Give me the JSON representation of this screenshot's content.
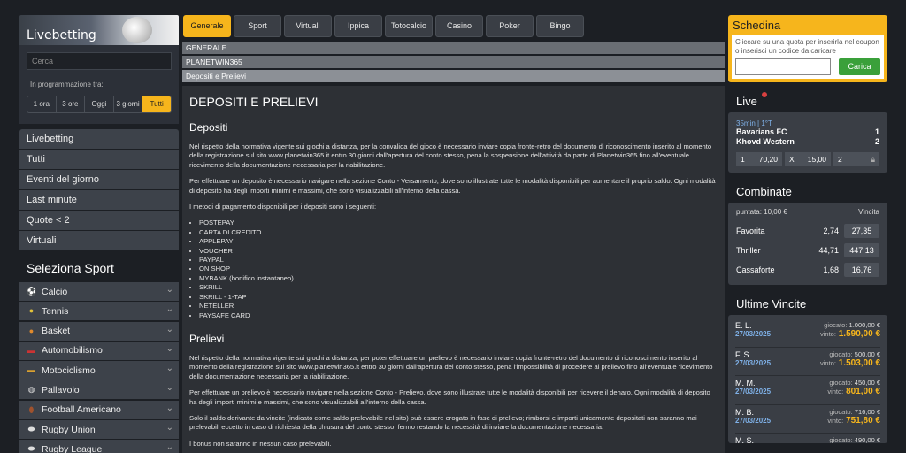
{
  "left": {
    "banner_title": "Livebetting",
    "search_placeholder": "Cerca",
    "prog_label": "In programmazione tra:",
    "time_filters": [
      "1 ora",
      "3 ore",
      "Oggi",
      "3 giorni",
      "Tutti"
    ],
    "time_selected": "Tutti",
    "menu": [
      "Livebetting",
      "Tutti",
      "Eventi del giorno",
      "Last minute",
      "Quote < 2",
      "Virtuali"
    ],
    "sport_title": "Seleziona Sport",
    "sports": [
      "Calcio",
      "Tennis",
      "Basket",
      "Automobilismo",
      "Motociclismo",
      "Pallavolo",
      "Football Americano",
      "Rugby Union",
      "Rugby League"
    ]
  },
  "tabs": [
    "Generale",
    "Sport",
    "Virtuali",
    "Ippica",
    "Totocalcio",
    "Casino",
    "Poker",
    "Bingo"
  ],
  "active_tab": "Generale",
  "breadcrumbs": [
    "GENERALE",
    "PLANETWIN365",
    "Depositi e Prelievi"
  ],
  "content": {
    "title": "DEPOSITI E PRELIEVI",
    "h_depositi": "Depositi",
    "p1": "Nel rispetto della normativa vigente sui giochi a distanza, per la convalida del gioco è necessario inviare copia fronte-retro del documento di riconoscimento inserito al momento della registrazione sul sito www.planetwin365.it entro 30 giorni dall'apertura del conto stesso, pena la sospensione dell'attività da parte di Planetwin365 fino all'eventuale ricevimento della documentazione necessaria per la riabilitazione.",
    "p2": "Per effettuare un deposito è necessario navigare nella sezione Conto - Versamento, dove sono illustrate tutte le modalità disponibili per aumentare il proprio saldo. Ogni modalità di deposito ha degli importi minimi e massimi, che sono visualizzabili all'interno della cassa.",
    "p3": "I metodi di pagamento disponibili per i depositi sono i seguenti:",
    "methods": [
      "POSTEPAY",
      "CARTA DI CREDITO",
      "APPLEPAY",
      "VOUCHER",
      "PAYPAL",
      "ON SHOP",
      "MYBANK (bonifico instantaneo)",
      "SKRILL",
      "SKRILL - 1-TAP",
      "NETELLER",
      "PAYSAFE CARD"
    ],
    "h_prelievi": "Prelievi",
    "p4": "Nel rispetto della normativa vigente sui giochi a distanza, per poter effettuare un prelievo è necessario inviare copia fronte-retro del documento di riconoscimento inserito al momento della registrazione sul sito www.planetwin365.it entro 30 giorni dall'apertura del conto stesso, pena l'impossibilità di procedere al prelievo fino all'eventuale ricevimento della documentazione necessaria per la riabilitazione.",
    "p5": "Per effettuare un prelievo è necessario navigare nella sezione Conto - Prelievo, dove sono illustrate tutte le modalità disponibili per ricevere il denaro. Ogni modalità di deposito ha degli importi minimi e massimi, che sono visualizzabili all'interno della cassa.",
    "p6": "Solo il saldo derivante da vincite (indicato come saldo prelevabile nel sito) può essere erogato in fase di prelievo; rimborsi e importi unicamente depositati non saranno mai prelevabili eccetto in caso di richiesta della chiusura del conto stesso, fermo restando la necessità di inviare la documentazione necessaria.",
    "p7": "I bonus non saranno in nessun caso prelevabili."
  },
  "schedina": {
    "title": "Schedina",
    "hint": "Cliccare su una quota per inserirla nel coupon o inserisci un codice da caricare",
    "button": "Carica"
  },
  "live": {
    "title": "Live",
    "time": "35min | 1°T",
    "team1": "Bavarians FC",
    "score1": "1",
    "team2": "Khovd Western",
    "score2": "2",
    "odds": [
      {
        "label": "1",
        "value": "70,20"
      },
      {
        "label": "X",
        "value": "15,00"
      },
      {
        "label": "2",
        "value": ""
      }
    ]
  },
  "combinate": {
    "title": "Combinate",
    "stake_label": "puntata:",
    "stake": "10,00 €",
    "win_label": "Vincita",
    "rows": [
      {
        "name": "Favorita",
        "odd": "2,74",
        "win": "27,35"
      },
      {
        "name": "Thriller",
        "odd": "44,71",
        "win": "447,13"
      },
      {
        "name": "Cassaforte",
        "odd": "1,68",
        "win": "16,76"
      }
    ]
  },
  "ultime": {
    "title": "Ultime Vincite",
    "played_label": "giocato:",
    "won_label": "vinto:",
    "rows": [
      {
        "name": "E. L.",
        "date": "27/03/2025",
        "played": "1.000,00 €",
        "won": "1.590,00 €"
      },
      {
        "name": "F. S.",
        "date": "27/03/2025",
        "played": "500,00 €",
        "won": "1.503,00 €"
      },
      {
        "name": "M. M.",
        "date": "27/03/2025",
        "played": "450,00 €",
        "won": "801,00 €"
      },
      {
        "name": "M. B.",
        "date": "27/03/2025",
        "played": "716,00 €",
        "won": "751,80 €"
      },
      {
        "name": "M. S.",
        "date": "",
        "played": "490,00 €",
        "won": ""
      }
    ]
  },
  "colors": {
    "accent": "#f6b51c",
    "bg": "#1c1f24",
    "panel": "#3a3e45",
    "green": "#3aa03a",
    "blue_date": "#7fb1e8"
  }
}
